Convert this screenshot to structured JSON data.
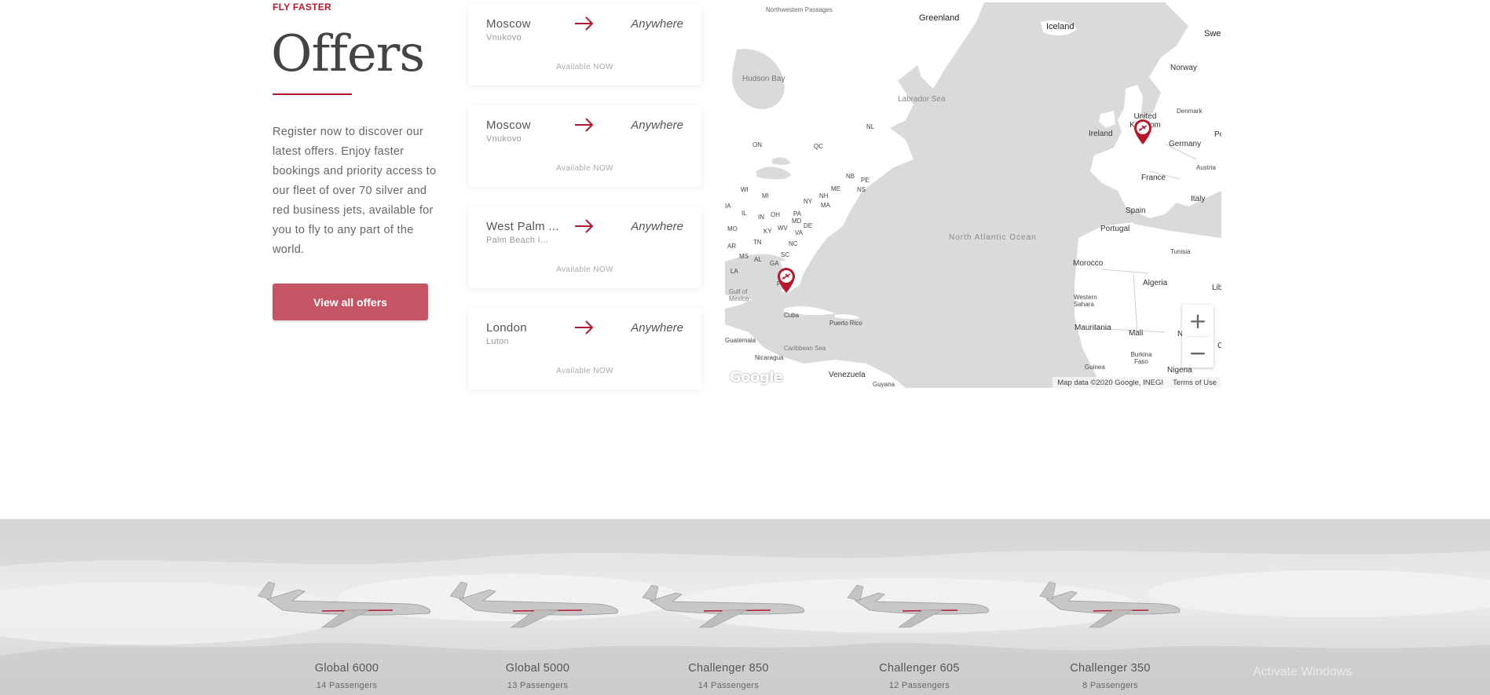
{
  "intro": {
    "eyebrow": "FLY FASTER",
    "title": "Offers",
    "description": "Register now to discover our latest offers. Enjoy faster bookings and priority access to our fleet of over 70 silver and red business jets, available for you to fly to any part of the world.",
    "cta_label": "View all offers"
  },
  "offers": [
    {
      "from": "Moscow",
      "airport": "Vnukovo",
      "to": "Anywhere",
      "availability": "Available NOW"
    },
    {
      "from": "Moscow",
      "airport": "Vnukovo",
      "to": "Anywhere",
      "availability": "Available NOW"
    },
    {
      "from": "West Palm ...",
      "airport": "Palm Beach I...",
      "to": "Anywhere",
      "availability": "Available NOW"
    },
    {
      "from": "London",
      "airport": "Luton",
      "to": "Anywhere",
      "availability": "Available NOW"
    }
  ],
  "map": {
    "labels": {
      "northwest_passages": "Northwestern Passages",
      "greenland": "Greenland",
      "iceland": "Iceland",
      "swe": "Swe",
      "hudson_bay": "Hudson Bay",
      "norway": "Norway",
      "labrador_sea": "Labrador Sea",
      "united_kingdom": "United Kingdom",
      "denmark": "Denmark",
      "ireland": "Ireland",
      "germany": "Germany",
      "po": "Po",
      "nl": "NL",
      "on": "ON",
      "qc": "QC",
      "austria": "Austria",
      "france": "France",
      "nb": "NB",
      "pe": "PE",
      "ns": "NS",
      "me": "ME",
      "nh": "NH",
      "wi": "WI",
      "mi": "MI",
      "ny": "NY",
      "ma": "MA",
      "italy": "Italy",
      "spain": "Spain",
      "portugal": "Portugal",
      "ia": "IA",
      "il": "IL",
      "in": "IN",
      "oh": "OH",
      "pa": "PA",
      "md": "MD",
      "de": "DE",
      "mo": "MO",
      "ky": "KY",
      "wv": "WV",
      "va": "VA",
      "north_atlantic_ocean": "North Atlantic Ocean",
      "tn": "TN",
      "nc": "NC",
      "ar": "AR",
      "ms": "MS",
      "al": "AL",
      "sc": "SC",
      "ga": "GA",
      "tunisia": "Tunisia",
      "morocco": "Morocco",
      "la": "LA",
      "algeria": "Algeria",
      "lib": "Lib",
      "gulf_of_mexico": "Gulf of Mexico",
      "fl": "FL",
      "western_sahara": "Western Sahara",
      "cuba": "Cuba",
      "puerto_rico": "Puerto Rico",
      "mauritania": "Mauritania",
      "mali": "Mali",
      "n": "N",
      "guatemala": "Guatemala",
      "caribbean_sea": "Caribbean Sea",
      "nicaragua": "Nicaragua",
      "burkina_faso": "Burkina Faso",
      "c": "C",
      "guinea": "Guinea",
      "nigeria": "Nigeria",
      "venezuela": "Venezuela",
      "guyana": "Guyana"
    },
    "google_logo": "Google",
    "attribution": "Map data ©2020 Google, INEGI",
    "terms": "Terms of Use",
    "zoom_in": "+",
    "zoom_out": "−"
  },
  "fleet": [
    {
      "name": "Global 6000",
      "passengers": "14 Passengers"
    },
    {
      "name": "Global 5000",
      "passengers": "13 Passengers"
    },
    {
      "name": "Challenger 850",
      "passengers": "14 Passengers"
    },
    {
      "name": "Challenger 605",
      "passengers": "12 Passengers"
    },
    {
      "name": "Challenger 350",
      "passengers": "8 Passengers"
    }
  ],
  "watermark": "Activate Windows",
  "colors": {
    "brand_red": "#b5192f",
    "button": "#c55565",
    "map_land": "#ffffff",
    "map_water": "#dadada"
  }
}
